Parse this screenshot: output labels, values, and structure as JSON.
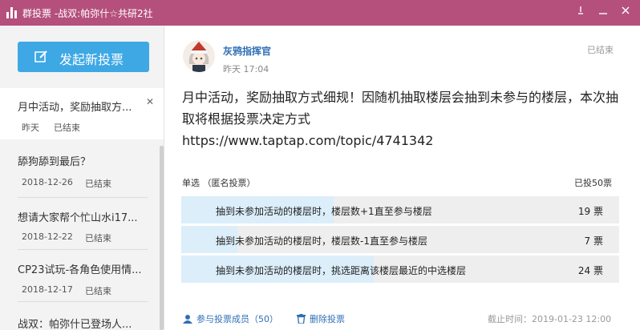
{
  "window": {
    "title": "群投票 -战双:帕弥什☆共研2社",
    "colors": {
      "titlebar": "#b5507d",
      "accent": "#3ea8e5",
      "link": "#2f6fb5"
    }
  },
  "sidebar": {
    "new_poll_label": "发起新投票",
    "items": [
      {
        "name": "月中活动，奖励抽取方...",
        "date": "昨天",
        "status": "已结束"
      },
      {
        "name": "舔狗舔到最后？",
        "date": "2018-12-26",
        "status": "已结束"
      },
      {
        "name": "想请大家帮个忙山水i17...",
        "date": "2018-12-22",
        "status": "已结束"
      },
      {
        "name": "CP23试玩-各角色使用情...",
        "date": "2018-12-17",
        "status": "已结束"
      },
      {
        "name": "战双：帕弥什已登场人...",
        "date": "",
        "status": ""
      }
    ]
  },
  "post": {
    "author": "灰鸦指挥官",
    "time": "昨天 17:04",
    "status": "已结束",
    "text": "月中活动，奖励抽取方式细规！因随机抽取楼层会抽到未参与的楼层，本次抽取将根据投票决定方式",
    "url": "https://www.taptap.com/topic/4741342"
  },
  "poll": {
    "type_label": "单选 （匿名投票）",
    "total_label": "已投50票",
    "total_votes": 50,
    "options": [
      {
        "label": "抽到未参加活动的楼层时，楼层数+1直至参与楼层",
        "votes_label": "19 票",
        "votes": 19
      },
      {
        "label": "抽到未参加活动的楼层时，楼层数-1直至参与楼层",
        "votes_label": "7 票",
        "votes": 7
      },
      {
        "label": "抽到未参加活动的楼层时，挑选距离该楼层最近的中选楼层",
        "votes_label": "24 票",
        "votes": 24
      }
    ]
  },
  "footer": {
    "participants_label": "参与投票成员（50）",
    "delete_label": "删除投票",
    "deadline": "截止时间：2019-01-23 12:00"
  },
  "icons": [
    "poll-bar-icon",
    "minimize-icon",
    "restore-icon",
    "close-icon",
    "edit-icon",
    "user-icon",
    "trash-icon"
  ]
}
